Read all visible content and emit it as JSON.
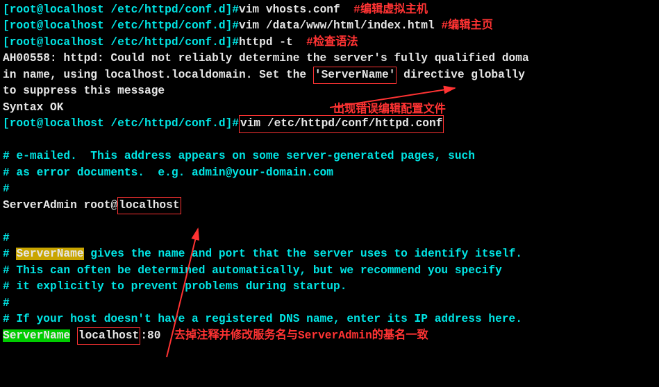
{
  "lines": {
    "l1_prompt": "[root@localhost /etc/httpd/conf.d]#",
    "l1_cmd": "vim vhosts.conf  ",
    "l1_note": "#编辑虚拟主机",
    "l2_prompt": "[root@localhost /etc/httpd/conf.d]#",
    "l2_cmd": "vim /data/www/html/index.html ",
    "l2_note": "#编辑主页",
    "l3_prompt": "[root@localhost /etc/httpd/conf.d]#",
    "l3_cmd": "httpd -t  ",
    "l3_note": "#检查语法",
    "l4a": "AH00558: httpd: Could not reliably determine the server's fully qualified doma",
    "l4b_a": "in name, using localhost.localdomain. Set the ",
    "l4b_box": "'ServerName'",
    "l4b_b": " directive globally ",
    "l4c": "to suppress this message",
    "l5": "Syntax OK",
    "l6_prompt": "[root@localhost /etc/httpd/conf.d]#",
    "l6_cmd": "vim /etc/httpd/conf/httpd.conf",
    "err_note": "出现错误编辑配置文件",
    "c1": "# e-mailed.  This address appears on some server-generated pages, such",
    "c2": "# as error documents.  e.g. admin@your-domain.com",
    "c3": "#",
    "sa_a": "ServerAdmin root@",
    "sa_box": "localhost",
    "c4": "#",
    "c5_a": "# ",
    "c5_hl": "ServerName",
    "c5_b": " gives the name and port that the server uses to identify itself.",
    "c6": "# This can often be determined automatically, but we recommend you specify",
    "c7": "# it explicitly to prevent problems during startup.",
    "c8": "#",
    "c9": "# If your host doesn't have a registered DNS name, enter its IP address here.",
    "sn_hl": "ServerName",
    "sn_sp": " ",
    "sn_box": "localhost",
    "sn_rest": ":80  ",
    "sn_note": "去掉注释并修改服务名与ServerAdmin的基名一致"
  }
}
